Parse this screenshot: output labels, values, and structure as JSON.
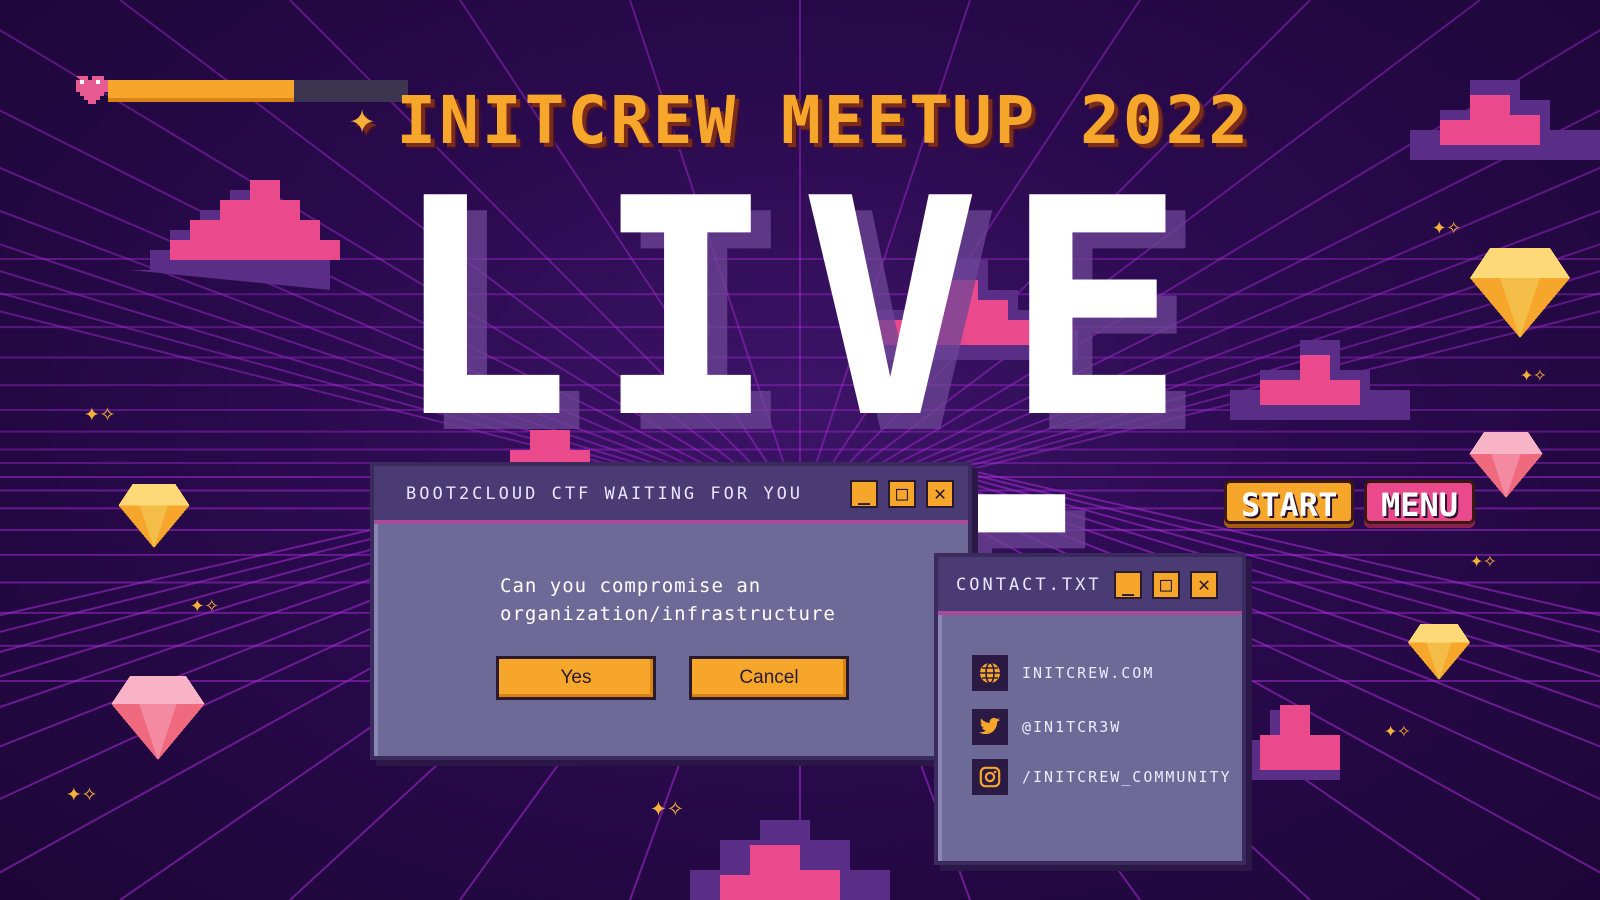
{
  "meetup_title": "INITCREW MEETUP 2022",
  "main_title": "LIVE CTF",
  "health": {
    "level": 0.62
  },
  "nav_buttons": {
    "start": "START",
    "menu": "MENU"
  },
  "dialog": {
    "title": "BOOT2CLOUD CTF WAITING FOR YOU",
    "message": "Can you compromise an organization/infrastructure",
    "yes": "Yes",
    "cancel": "Cancel"
  },
  "contact": {
    "title": "CONTACT.TXT",
    "items": [
      {
        "icon": "globe-icon",
        "label": "INITCREW.COM"
      },
      {
        "icon": "twitter-icon",
        "label": "@IN1TCR3W"
      },
      {
        "icon": "instagram-icon",
        "label": "/INITCREW_COMMUNITY"
      }
    ]
  },
  "window_controls": {
    "minimize": "_",
    "maximize": "□",
    "close": "✕"
  },
  "colors": {
    "accent_orange": "#f6a62a",
    "accent_pink": "#ea4a8c",
    "background": "#2a0a4e",
    "grid": "#a82bd6",
    "window_body": "#6d6a98",
    "window_title": "#4a3b75"
  }
}
